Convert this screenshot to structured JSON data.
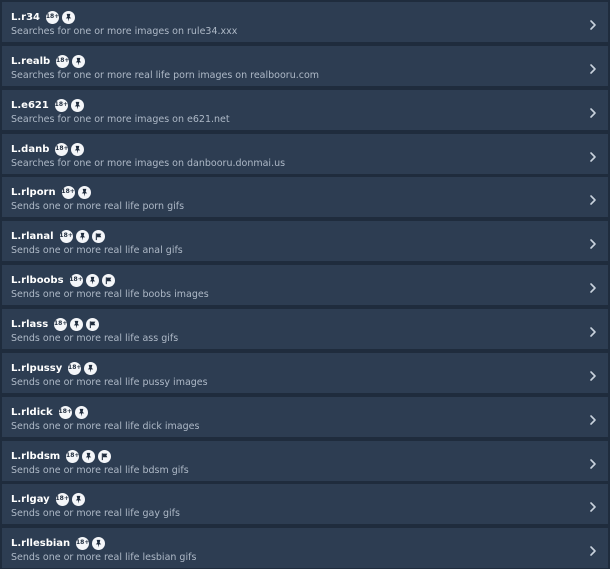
{
  "commands": [
    {
      "name": "L.r34",
      "desc": "Searches for one or more images on rule34.xxx",
      "badges": [
        "nsfw-18",
        "pin"
      ]
    },
    {
      "name": "L.realb",
      "desc": "Searches for one or more real life porn images on realbooru.com",
      "badges": [
        "nsfw-18",
        "pin"
      ]
    },
    {
      "name": "L.e621",
      "desc": "Searches for one or more images on e621.net",
      "badges": [
        "nsfw-18",
        "pin"
      ]
    },
    {
      "name": "L.danb",
      "desc": "Searches for one or more images on danbooru.donmai.us",
      "badges": [
        "nsfw-18",
        "pin"
      ]
    },
    {
      "name": "L.rlporn",
      "desc": "Sends one or more real life porn gifs",
      "badges": [
        "nsfw-18",
        "pin"
      ]
    },
    {
      "name": "L.rlanal",
      "desc": "Sends one or more real life anal gifs",
      "badges": [
        "nsfw-18",
        "pin",
        "flag"
      ]
    },
    {
      "name": "L.rlboobs",
      "desc": "Sends one or more real life boobs images",
      "badges": [
        "nsfw-18",
        "pin",
        "flag"
      ]
    },
    {
      "name": "L.rlass",
      "desc": "Sends one or more real life ass gifs",
      "badges": [
        "nsfw-18",
        "pin",
        "flag"
      ]
    },
    {
      "name": "L.rlpussy",
      "desc": "Sends one or more real life pussy images",
      "badges": [
        "nsfw-18",
        "pin"
      ]
    },
    {
      "name": "L.rldick",
      "desc": "Sends one or more real life dick images",
      "badges": [
        "nsfw-18",
        "pin"
      ]
    },
    {
      "name": "L.rlbdsm",
      "desc": "Sends one or more real life bdsm gifs",
      "badges": [
        "nsfw-18",
        "pin",
        "flag"
      ]
    },
    {
      "name": "L.rlgay",
      "desc": "Sends one or more real life gay gifs",
      "badges": [
        "nsfw-18",
        "pin"
      ]
    },
    {
      "name": "L.rllesbian",
      "desc": "Sends one or more real life lesbian gifs",
      "badges": [
        "nsfw-18",
        "pin"
      ]
    }
  ],
  "badge_text": {
    "nsfw-18": "18+"
  },
  "colors": {
    "background": "#1f2c3d",
    "row": "#2d3d52",
    "title": "#ffffff",
    "description": "#aeb9c7",
    "chevron": "#c9d2dd",
    "badge": "#f4f6f9"
  },
  "icons": {
    "row_action": "chevron-right-icon"
  }
}
